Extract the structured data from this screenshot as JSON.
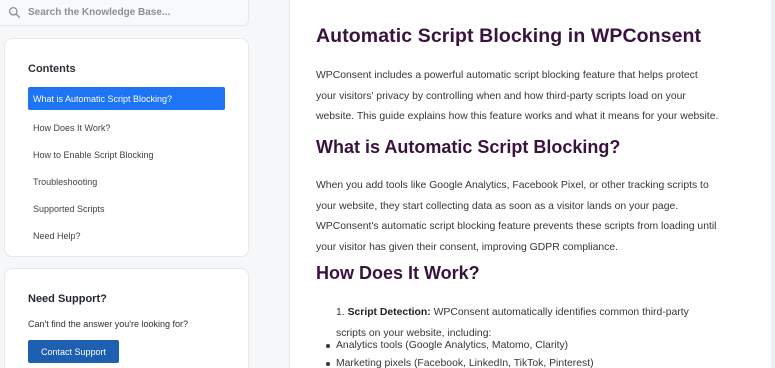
{
  "search": {
    "placeholder": "Search the Knowledge Base..."
  },
  "toc": {
    "title": "Contents",
    "items": [
      {
        "label": "What is Automatic Script Blocking?",
        "active": true
      },
      {
        "label": "How Does It Work?"
      },
      {
        "label": "How to Enable Script Blocking"
      },
      {
        "label": "Troubleshooting"
      },
      {
        "label": "Supported Scripts"
      },
      {
        "label": "Need Help?"
      }
    ]
  },
  "support": {
    "title": "Need Support?",
    "text": "Can't find the answer you're looking for?",
    "button": "Contact Support"
  },
  "article": {
    "title": "Automatic Script Blocking in WPConsent",
    "intro": [
      "WPConsent includes a powerful automatic script blocking feature that helps protect",
      "your visitors' privacy by controlling when and how third-party scripts load on your",
      "website. This guide explains how this feature works and what it means for your website."
    ],
    "section1_title": "What is Automatic Script Blocking?",
    "section1_body": [
      "When you add tools like Google Analytics, Facebook Pixel, or other tracking scripts to",
      "your website, they start collecting data as soon as a visitor lands on your page.",
      "WPConsent's automatic script blocking feature prevents these scripts from loading until",
      "your visitor has given their consent, improving GDPR compliance."
    ],
    "section2_title": "How Does It Work?",
    "step1_number": "1.",
    "step1_label": "Script Detection:",
    "step1_text_line1": "WPConsent automatically identifies common third-party",
    "step1_text_line2": "scripts on your website, including:",
    "bullets": [
      "Analytics tools (Google Analytics, Matomo, Clarity)",
      "Marketing pixels (Facebook, LinkedIn, TikTok, Pinterest)"
    ]
  },
  "colors": {
    "accent": "#1d74f5",
    "button": "#1d5fb0",
    "heading": "#3a1240"
  }
}
